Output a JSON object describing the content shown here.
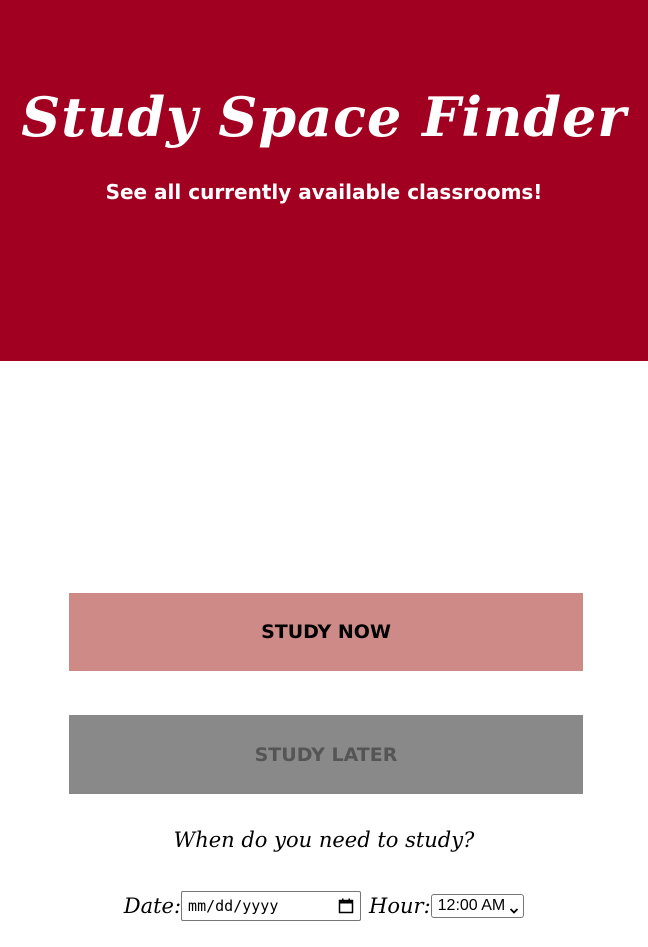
{
  "header": {
    "title": "Study Space Finder",
    "subtitle": "See all currently available classrooms!"
  },
  "actions": {
    "study_now_label": "STUDY NOW",
    "study_later_label": "STUDY LATER"
  },
  "schedule": {
    "prompt": "When do you need to study?",
    "date_label": "Date:",
    "date_placeholder": "mm/dd/yyyy",
    "hour_label": "Hour:",
    "hour_selected": "12:00 AM"
  },
  "colors": {
    "header_bg": "#a10021",
    "study_now_bg": "#cd8a86",
    "study_later_bg": "#898989"
  },
  "icons": {
    "date_picker": "calendar-icon",
    "hour_select": "chevron-down-icon"
  }
}
